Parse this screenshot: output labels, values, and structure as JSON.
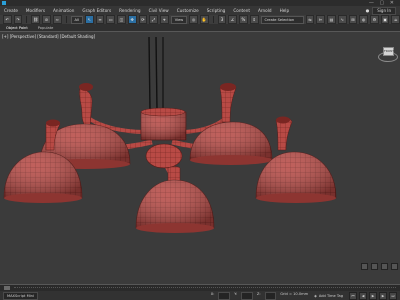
{
  "menubar": {
    "items": [
      "Create",
      "Modifiers",
      "Animation",
      "Graph Editors",
      "Rendering",
      "Civil View",
      "Customize",
      "Scripting",
      "Content",
      "Arnold",
      "Help"
    ],
    "signin": "Sign In"
  },
  "toolbar": {
    "selection_filter": "All",
    "named_selection": "Create Selection Set",
    "active_tool": "select-move"
  },
  "ribbon": {
    "tabs": [
      "Object Paint",
      "Populate"
    ]
  },
  "viewport": {
    "label": "[+] [Perspective] [Standard] [Default Shading]",
    "viewcube_face": "FRONT"
  },
  "status": {
    "maxscript_label": "MAXScript Mini",
    "grid_label": "Grid = 10.0mm",
    "addtag_label": "Add Time Tag",
    "x": "X:",
    "y": "Y:",
    "z": "Z:"
  },
  "colors": {
    "mesh_fill": "#b84a45",
    "mesh_wire": "#6a1f1c",
    "viewport_bg": "#3b3b3b"
  }
}
